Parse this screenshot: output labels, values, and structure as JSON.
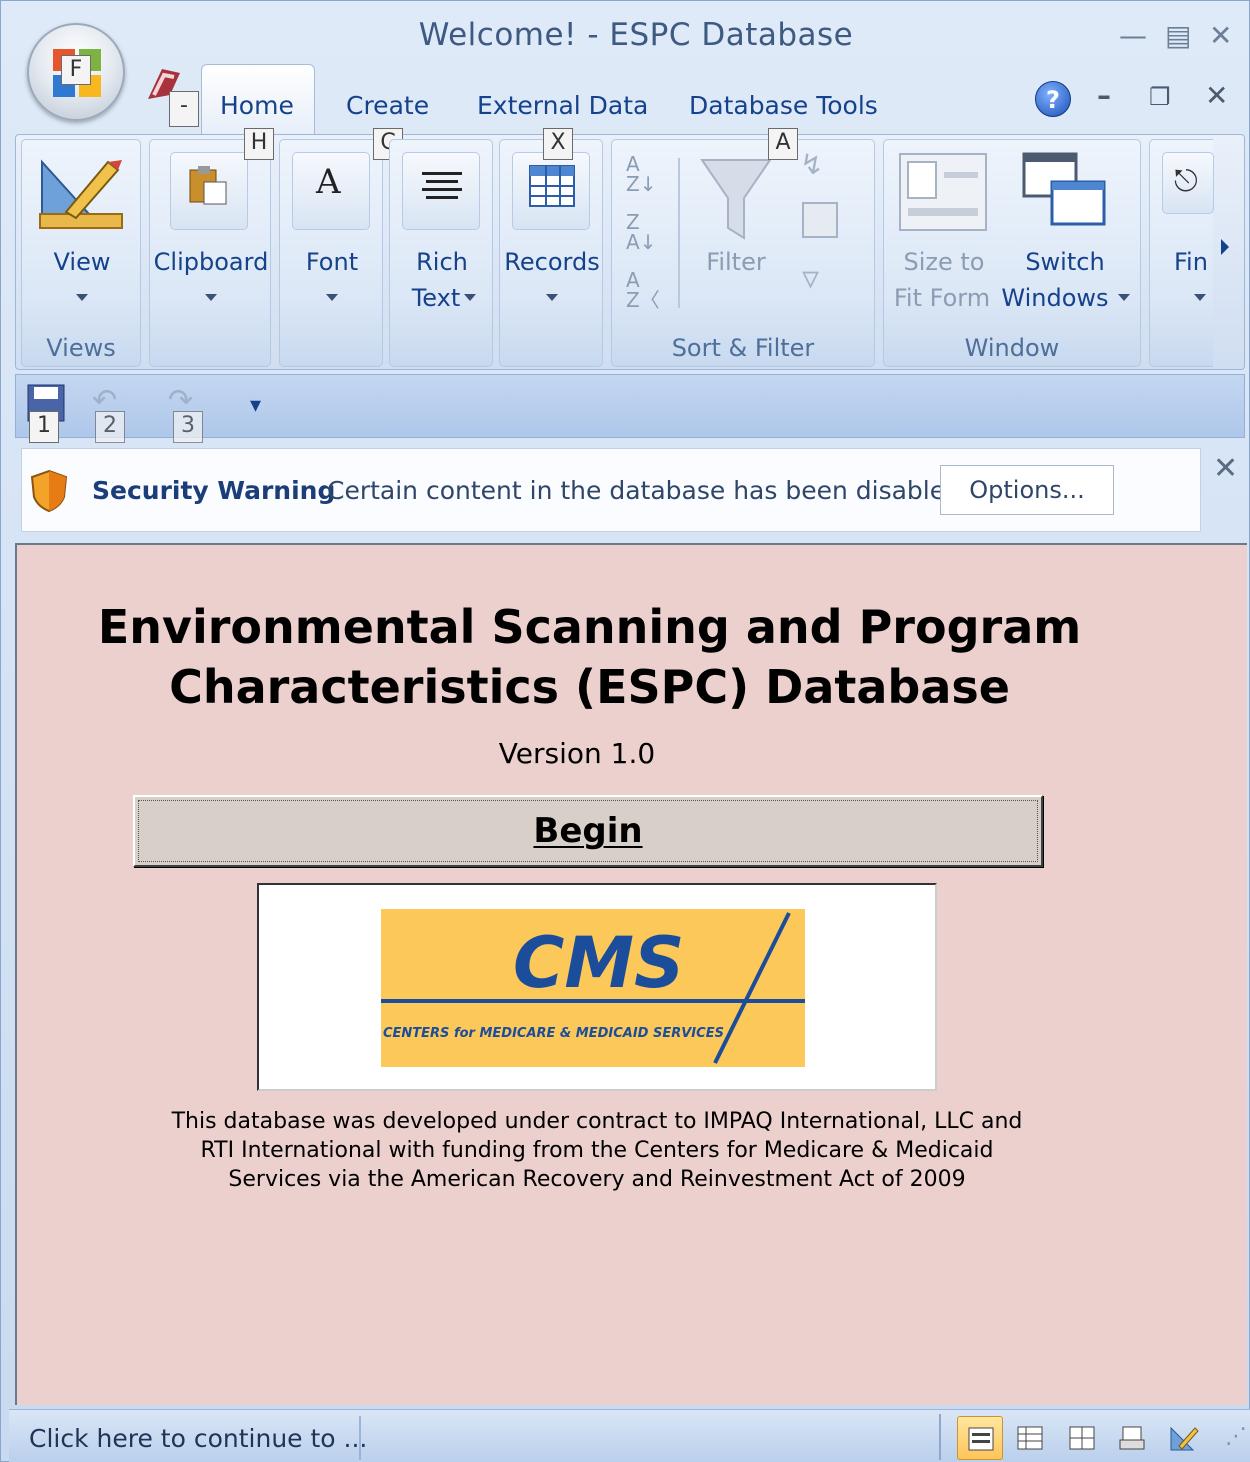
{
  "window": {
    "title": "Welcome! - ESPC Database"
  },
  "keytips": {
    "office": "F",
    "qat_menu": "-",
    "home": "H",
    "create": "C",
    "external": "X",
    "dbtools": "A",
    "qat1": "1",
    "qat2": "2",
    "qat3": "3"
  },
  "tabs": [
    {
      "label": "Home"
    },
    {
      "label": "Create"
    },
    {
      "label": "External Data"
    },
    {
      "label": "Database Tools"
    }
  ],
  "ribbon": {
    "view_label": "View",
    "views_group": "Views",
    "clipboard_label": "Clipboard",
    "font_label": "Font",
    "rich_label": "Rich",
    "text_label": "Text",
    "records_label": "Records",
    "filter_label": "Filter",
    "sort_filter_group": "Sort & Filter",
    "size_label": "Size to",
    "fitform_label": "Fit Form",
    "switch_label": "Switch",
    "windows_label": "Windows",
    "window_group": "Window",
    "find_label": "Fin"
  },
  "security": {
    "title": "Security Warning",
    "message": "Certain content in the database has been disabled",
    "options_label": "Options..."
  },
  "form": {
    "title_line1": "Environmental Scanning and Program",
    "title_line2": "Characteristics (ESPC) Database",
    "version": "Version 1.0",
    "begin_label": "Begin",
    "logo_text": "CMS",
    "logo_subtext": "CENTERS for MEDICARE & MEDICAID SERVICES",
    "footer_line1": "This database was developed under contract to IMPAQ International, LLC and",
    "footer_line2": "RTI International with funding from the Centers for Medicare & Medicaid",
    "footer_line3": "Services via the American Recovery and Reinvestment Act of 2009"
  },
  "status": {
    "text": "Click here to continue to ..."
  },
  "colors": {
    "form_background": "#ecd0cd",
    "cms_logo_bg": "#fcc85a",
    "cms_logo_fg": "#1b4d9b"
  }
}
